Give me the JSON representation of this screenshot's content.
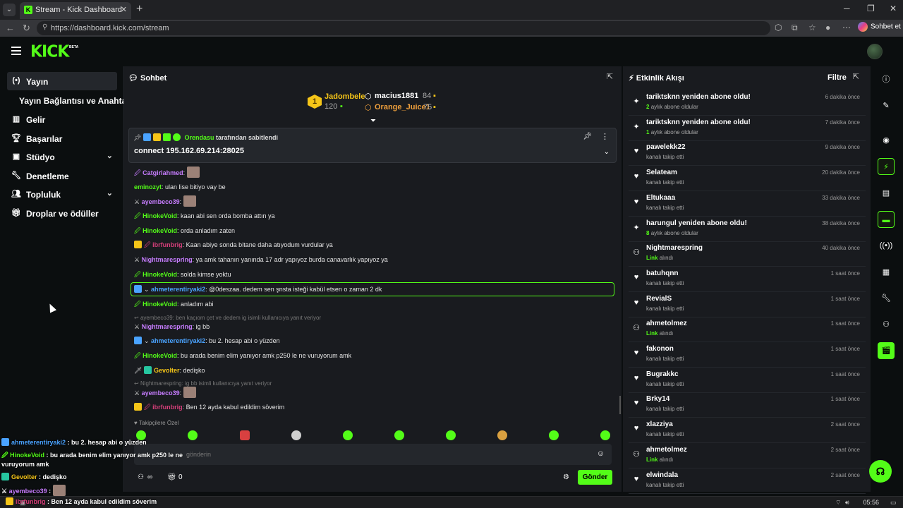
{
  "browser": {
    "tab_title": "Stream - Kick Dashboard",
    "url": "https://dashboard.kick.com/stream",
    "copilot_label": "Sohbet et"
  },
  "app": {
    "logo": "KICK",
    "logo_badge": "BETA"
  },
  "sidebar": {
    "items": [
      {
        "label": "Yayın",
        "icon": "broadcast-icon",
        "active": true
      },
      {
        "label": "Yayın Bağlantısı ve Anahtarı",
        "icon": "",
        "active": false
      },
      {
        "label": "Gelir",
        "icon": "chart-icon",
        "active": false
      },
      {
        "label": "Başarılar",
        "icon": "trophy-icon",
        "active": false
      },
      {
        "label": "Stüdyo",
        "icon": "camera-icon",
        "active": false,
        "expandable": true
      },
      {
        "label": "Denetleme",
        "icon": "wrench-icon",
        "active": false
      },
      {
        "label": "Topluluk",
        "icon": "people-icon",
        "active": false,
        "expandable": true
      },
      {
        "label": "Droplar ve ödüller",
        "icon": "gift-icon",
        "active": false
      }
    ]
  },
  "chat": {
    "title": "Sohbet",
    "leaderboard": [
      {
        "rank": "1",
        "name": "Jadombele",
        "amount": "120"
      },
      {
        "name": "macius1881",
        "amount": "84"
      },
      {
        "name": "Orange_Juice1",
        "amount": "75"
      }
    ],
    "pinned": {
      "pinned_by_user": "Orendasu",
      "pinned_by_text": "tarafından sabitlendi",
      "message": "connect 195.162.69.214:28025"
    },
    "messages": [
      {
        "user": "Catgirlahmed",
        "color": "#c77dff",
        "text": ""
      },
      {
        "user": "eminozyt",
        "color": "#53fc18",
        "text": "ulan lise bitiyo vay be"
      },
      {
        "user": "ayembeco39",
        "color": "#c77dff",
        "text": ""
      },
      {
        "user": "HinokeVoid",
        "color": "#53fc18",
        "text": "kaan abi sen orda bomba attın ya"
      },
      {
        "user": "HinokeVoid",
        "color": "#53fc18",
        "text": "orda anladım zaten"
      },
      {
        "user": "ibrfunbrig",
        "color": "#d63f7a",
        "text": "Kaan abiye sonda bitane daha atıyodum vurdular ya"
      },
      {
        "user": "Nightmarespring",
        "color": "#c77dff",
        "text": "ya amk tahanın yanında 17 adr yapıyoz burda canavarlık yapıyoz ya"
      },
      {
        "user": "HinokeVoid",
        "color": "#53fc18",
        "text": "solda kimse yoktu"
      },
      {
        "user": "ahmeterentiryaki2",
        "color": "#4aa3ff",
        "text": "@0deszaa. dedem sen şnsta isteği kabül etsen o zaman 2 dk"
      },
      {
        "user": "HinokeVoid",
        "color": "#53fc18",
        "text": "anladım abi"
      },
      {
        "user": "Nightmarespring",
        "color": "#c77dff",
        "text": "ig bb",
        "reply": "ayembeco39: ben kaçıom çet ve dedem ig isimli kullanıcıya yanıt veriyor"
      },
      {
        "user": "ahmeterentiryaki2",
        "color": "#4aa3ff",
        "text": "bu 2. hesap abi o yüzden"
      },
      {
        "user": "HinokeVoid",
        "color": "#53fc18",
        "text": "bu arada benim elim yanıyor amk p250 le ne vuruyorum amk"
      },
      {
        "user": "Gevolter",
        "color": "#f5c518",
        "text": "dedişko"
      },
      {
        "user": "ayembeco39",
        "color": "#c77dff",
        "text": "",
        "reply": "Nightmarespring: ig bb isimli kullanıcıya yanıt veriyor"
      },
      {
        "user": "ibrfunbrig",
        "color": "#d63f7a",
        "text": "Ben 12 ayda kabul edildim söverim"
      }
    ],
    "followers_only": "Takipçilere Özel",
    "input_placeholder": "gönderin",
    "points_label": "∞",
    "gifts_count": "0",
    "send_label": "Gönder"
  },
  "activity": {
    "title": "Etkinlik Akışı",
    "filter_label": "Filtre",
    "items": [
      {
        "type": "resub",
        "name": "tariktsknn yeniden abone oldu!",
        "highlight": "2",
        "sub": "aylık abone oldular",
        "time": "6 dakika önce"
      },
      {
        "type": "resub",
        "name": "tariktsknn yeniden abone oldu!",
        "highlight": "1",
        "sub": "aylık abone oldular",
        "time": "7 dakika önce"
      },
      {
        "type": "follow",
        "name": "pawelekk22",
        "highlight": "",
        "sub": "kanalı takip etti",
        "time": "9 dakika önce"
      },
      {
        "type": "follow",
        "name": "Selateam",
        "highlight": "",
        "sub": "kanalı takip etti",
        "time": "20 dakika önce"
      },
      {
        "type": "follow",
        "name": "Eltukaaa",
        "highlight": "",
        "sub": "kanalı takip etti",
        "time": "33 dakika önce"
      },
      {
        "type": "resub",
        "name": "harungul yeniden abone oldu!",
        "highlight": "8",
        "sub": "aylık abone oldular",
        "time": "38 dakika önce"
      },
      {
        "type": "link",
        "name": "Nightmarespring",
        "highlight": "Link",
        "sub": "alındı",
        "time": "40 dakika önce"
      },
      {
        "type": "follow",
        "name": "batuhqnn",
        "highlight": "",
        "sub": "kanalı takip etti",
        "time": "1 saat önce"
      },
      {
        "type": "follow",
        "name": "RevialS",
        "highlight": "",
        "sub": "kanalı takip etti",
        "time": "1 saat önce"
      },
      {
        "type": "link",
        "name": "ahmetolmez",
        "highlight": "Link",
        "sub": "alındı",
        "time": "1 saat önce"
      },
      {
        "type": "follow",
        "name": "fakonon",
        "highlight": "",
        "sub": "kanalı takip etti",
        "time": "1 saat önce"
      },
      {
        "type": "follow",
        "name": "Bugrakkc",
        "highlight": "",
        "sub": "kanalı takip etti",
        "time": "1 saat önce"
      },
      {
        "type": "follow",
        "name": "Brky14",
        "highlight": "",
        "sub": "kanalı takip etti",
        "time": "1 saat önce"
      },
      {
        "type": "follow",
        "name": "xlazziya",
        "highlight": "",
        "sub": "kanalı takip etti",
        "time": "2 saat önce"
      },
      {
        "type": "link",
        "name": "ahmetolmez",
        "highlight": "Link",
        "sub": "alındı",
        "time": "2 saat önce"
      },
      {
        "type": "follow",
        "name": "elwindala",
        "highlight": "",
        "sub": "kanalı takip etti",
        "time": "2 saat önce"
      }
    ]
  },
  "overlay_chat": [
    {
      "user": "ahmeterentiryaki2",
      "color": "#4aa3ff",
      "text": ": bu 2. hesap abi o yüzden"
    },
    {
      "user": "HinokeVoid",
      "color": "#53fc18",
      "text": ": bu arada benim elim yanıyor amk p250 le ne"
    },
    {
      "user": "",
      "color": "#fff",
      "text": "vuruyorum amk"
    },
    {
      "user": "Gevolter",
      "color": "#f5c518",
      "text": ": dedişko"
    },
    {
      "user": "ayembeco39",
      "color": "#c77dff",
      "text": ":"
    },
    {
      "user": "ibrfunbrig",
      "color": "#d63f7a",
      "text": ": Ben 12 ayda kabul edildim söverim"
    }
  ],
  "taskbar": {
    "clock": "05:56"
  },
  "colors": {
    "accent": "#53fc18",
    "panel": "#191b1f",
    "background": "#0b0e0f"
  }
}
